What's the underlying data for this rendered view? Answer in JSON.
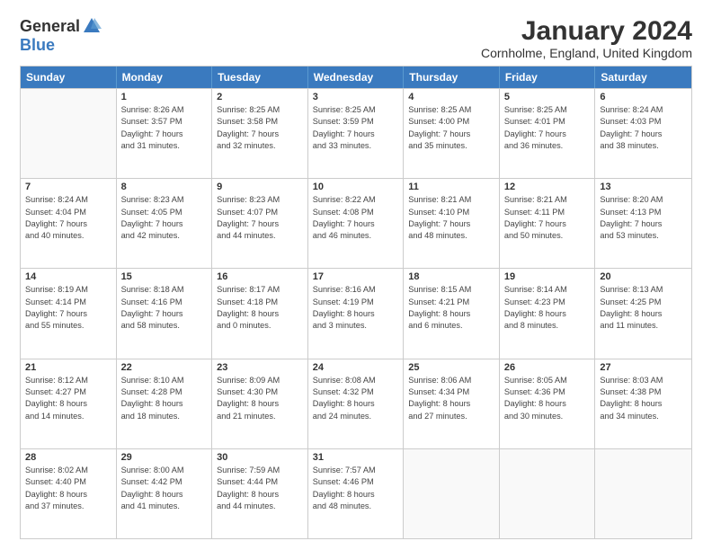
{
  "logo": {
    "general": "General",
    "blue": "Blue"
  },
  "title": "January 2024",
  "location": "Cornholme, England, United Kingdom",
  "day_headers": [
    "Sunday",
    "Monday",
    "Tuesday",
    "Wednesday",
    "Thursday",
    "Friday",
    "Saturday"
  ],
  "weeks": [
    [
      {
        "day": "",
        "empty": true
      },
      {
        "day": "1",
        "sunrise": "8:26 AM",
        "sunset": "3:57 PM",
        "daylight": "7 hours and 31 minutes."
      },
      {
        "day": "2",
        "sunrise": "8:25 AM",
        "sunset": "3:58 PM",
        "daylight": "7 hours and 32 minutes."
      },
      {
        "day": "3",
        "sunrise": "8:25 AM",
        "sunset": "3:59 PM",
        "daylight": "7 hours and 33 minutes."
      },
      {
        "day": "4",
        "sunrise": "8:25 AM",
        "sunset": "4:00 PM",
        "daylight": "7 hours and 35 minutes."
      },
      {
        "day": "5",
        "sunrise": "8:25 AM",
        "sunset": "4:01 PM",
        "daylight": "7 hours and 36 minutes."
      },
      {
        "day": "6",
        "sunrise": "8:24 AM",
        "sunset": "4:03 PM",
        "daylight": "7 hours and 38 minutes."
      }
    ],
    [
      {
        "day": "7",
        "sunrise": "8:24 AM",
        "sunset": "4:04 PM",
        "daylight": "7 hours and 40 minutes."
      },
      {
        "day": "8",
        "sunrise": "8:23 AM",
        "sunset": "4:05 PM",
        "daylight": "7 hours and 42 minutes."
      },
      {
        "day": "9",
        "sunrise": "8:23 AM",
        "sunset": "4:07 PM",
        "daylight": "7 hours and 44 minutes."
      },
      {
        "day": "10",
        "sunrise": "8:22 AM",
        "sunset": "4:08 PM",
        "daylight": "7 hours and 46 minutes."
      },
      {
        "day": "11",
        "sunrise": "8:21 AM",
        "sunset": "4:10 PM",
        "daylight": "7 hours and 48 minutes."
      },
      {
        "day": "12",
        "sunrise": "8:21 AM",
        "sunset": "4:11 PM",
        "daylight": "7 hours and 50 minutes."
      },
      {
        "day": "13",
        "sunrise": "8:20 AM",
        "sunset": "4:13 PM",
        "daylight": "7 hours and 53 minutes."
      }
    ],
    [
      {
        "day": "14",
        "sunrise": "8:19 AM",
        "sunset": "4:14 PM",
        "daylight": "7 hours and 55 minutes."
      },
      {
        "day": "15",
        "sunrise": "8:18 AM",
        "sunset": "4:16 PM",
        "daylight": "7 hours and 58 minutes."
      },
      {
        "day": "16",
        "sunrise": "8:17 AM",
        "sunset": "4:18 PM",
        "daylight": "8 hours and 0 minutes."
      },
      {
        "day": "17",
        "sunrise": "8:16 AM",
        "sunset": "4:19 PM",
        "daylight": "8 hours and 3 minutes."
      },
      {
        "day": "18",
        "sunrise": "8:15 AM",
        "sunset": "4:21 PM",
        "daylight": "8 hours and 6 minutes."
      },
      {
        "day": "19",
        "sunrise": "8:14 AM",
        "sunset": "4:23 PM",
        "daylight": "8 hours and 8 minutes."
      },
      {
        "day": "20",
        "sunrise": "8:13 AM",
        "sunset": "4:25 PM",
        "daylight": "8 hours and 11 minutes."
      }
    ],
    [
      {
        "day": "21",
        "sunrise": "8:12 AM",
        "sunset": "4:27 PM",
        "daylight": "8 hours and 14 minutes."
      },
      {
        "day": "22",
        "sunrise": "8:10 AM",
        "sunset": "4:28 PM",
        "daylight": "8 hours and 18 minutes."
      },
      {
        "day": "23",
        "sunrise": "8:09 AM",
        "sunset": "4:30 PM",
        "daylight": "8 hours and 21 minutes."
      },
      {
        "day": "24",
        "sunrise": "8:08 AM",
        "sunset": "4:32 PM",
        "daylight": "8 hours and 24 minutes."
      },
      {
        "day": "25",
        "sunrise": "8:06 AM",
        "sunset": "4:34 PM",
        "daylight": "8 hours and 27 minutes."
      },
      {
        "day": "26",
        "sunrise": "8:05 AM",
        "sunset": "4:36 PM",
        "daylight": "8 hours and 30 minutes."
      },
      {
        "day": "27",
        "sunrise": "8:03 AM",
        "sunset": "4:38 PM",
        "daylight": "8 hours and 34 minutes."
      }
    ],
    [
      {
        "day": "28",
        "sunrise": "8:02 AM",
        "sunset": "4:40 PM",
        "daylight": "8 hours and 37 minutes."
      },
      {
        "day": "29",
        "sunrise": "8:00 AM",
        "sunset": "4:42 PM",
        "daylight": "8 hours and 41 minutes."
      },
      {
        "day": "30",
        "sunrise": "7:59 AM",
        "sunset": "4:44 PM",
        "daylight": "8 hours and 44 minutes."
      },
      {
        "day": "31",
        "sunrise": "7:57 AM",
        "sunset": "4:46 PM",
        "daylight": "8 hours and 48 minutes."
      },
      {
        "day": "",
        "empty": true
      },
      {
        "day": "",
        "empty": true
      },
      {
        "day": "",
        "empty": true
      }
    ]
  ]
}
